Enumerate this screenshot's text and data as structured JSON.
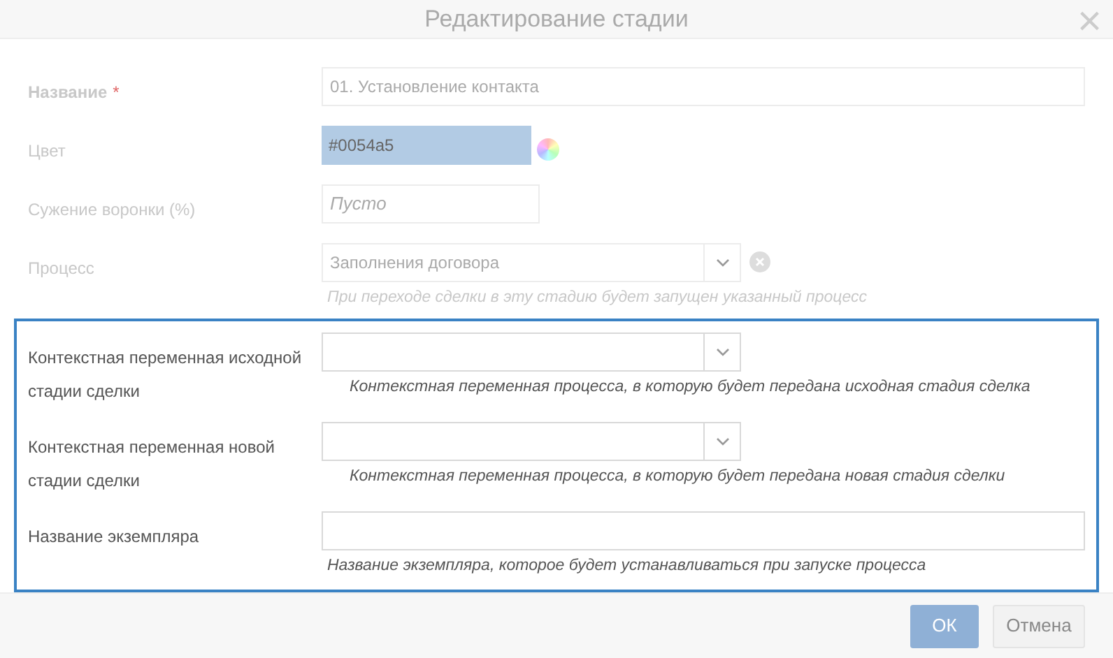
{
  "dialog": {
    "title": "Редактирование стадии",
    "close": "×"
  },
  "sections": [
    {
      "highlighted": false,
      "fields": [
        {
          "kind": "text",
          "label": "Название",
          "required_mark": "*",
          "value": "01. Установление контакта"
        },
        {
          "kind": "color",
          "label": "Цвет",
          "value": "#0054a5"
        },
        {
          "kind": "short",
          "label": "Сужение воронки (%)",
          "placeholder": "Пусто"
        },
        {
          "kind": "select",
          "label": "Процесс",
          "value": "Заполнения договора",
          "clearable": true,
          "hint": "При переходе сделки в эту стадию будет запущен указанный процесс"
        }
      ]
    },
    {
      "highlighted": true,
      "fields": [
        {
          "kind": "select",
          "label": "Контекстная переменная исходной стадии сделки",
          "hint": "Контекстная переменная процесса, в которую будет передана исходная стадия сделка"
        },
        {
          "kind": "select",
          "label": "Контекстная переменная новой стадии сделки",
          "hint": "Контекстная переменная процесса, в которую будет передана новая стадия сделки"
        },
        {
          "kind": "text",
          "label": "Название экземпляра",
          "hint": "Название экземпляра, которое будет устанавливаться при запуске процесса"
        }
      ]
    }
  ],
  "buttons": [
    {
      "kind": "primary",
      "label": "ОК"
    },
    {
      "kind": "secondary",
      "label": "Отмена"
    }
  ]
}
